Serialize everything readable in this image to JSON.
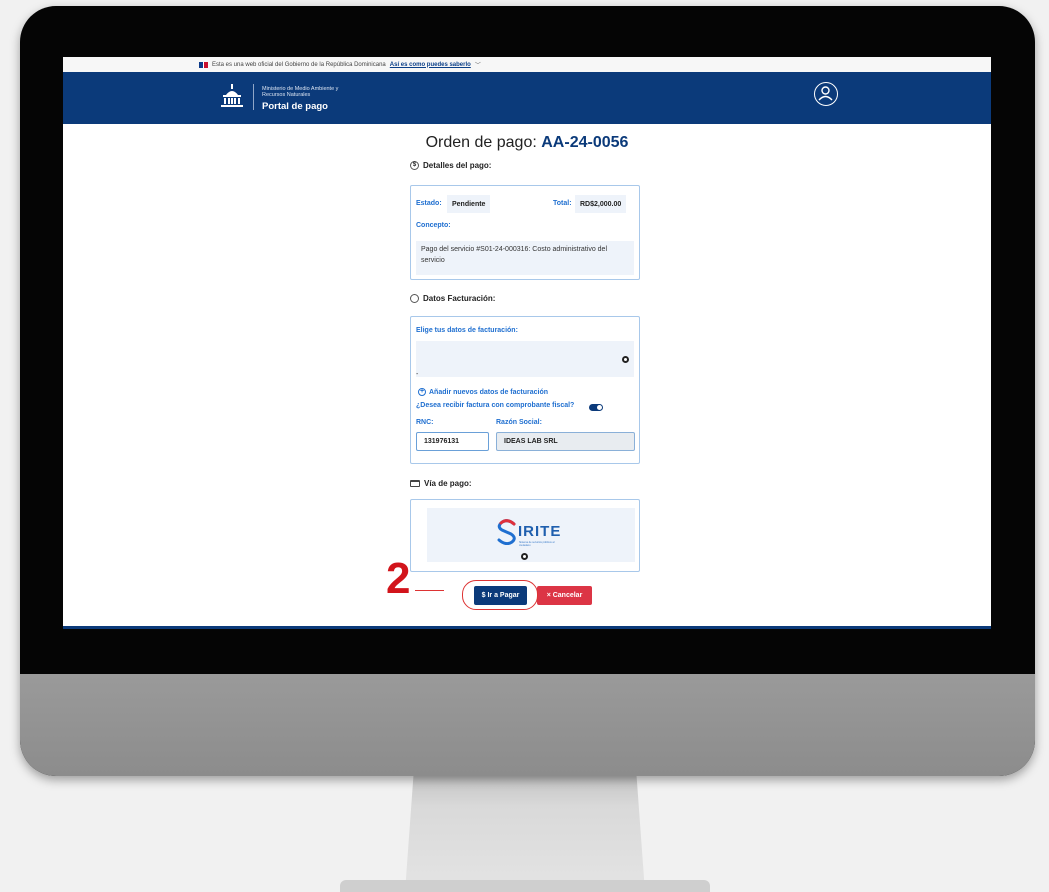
{
  "gov_bar": {
    "text": "Esta es una web oficial del Gobierno de la República Dominicana",
    "link": "Así es como puedes saberlo"
  },
  "header": {
    "ministry_line1": "Ministerio de Medio Ambiente y",
    "ministry_line2": "Recursos Naturales",
    "portal_title": "Portal de pago"
  },
  "page": {
    "title_prefix": "Orden de pago:",
    "order_id": "AA-24-0056"
  },
  "payment_details": {
    "section_title": "Detalles del pago:",
    "status_label": "Estado:",
    "status_value": "Pendiente",
    "total_label": "Total:",
    "total_value": "RD$2,000.00",
    "concept_label": "Concepto:",
    "concept_value": "Pago del servicio #S01-24-000316: Costo administrativo del servicio"
  },
  "billing": {
    "section_title": "Datos Facturación:",
    "choose_label": "Elige tus datos de facturación:",
    "dash": "-",
    "add_link": "Añadir nuevos datos de facturación",
    "fiscal_question": "¿Desea recibir factura con comprobante fiscal?",
    "rnc_label": "RNC:",
    "rnc_value": "131976131",
    "business_label": "Razón Social:",
    "business_value": "IDEAS LAB SRL"
  },
  "payment_method": {
    "section_title": "Vía de pago:",
    "provider_name": "IRITE",
    "provider_tagline": "Sistema de servicios públicos al ciudadano"
  },
  "actions": {
    "pay_label": "$ Ir a Pagar",
    "cancel_label": "× Cancelar"
  },
  "annotation": {
    "step_number": "2"
  },
  "colors": {
    "brand_blue": "#0b3a7a",
    "link_blue": "#1f6fd0",
    "danger_red": "#dc3545",
    "annotation_red": "#d2141b"
  }
}
